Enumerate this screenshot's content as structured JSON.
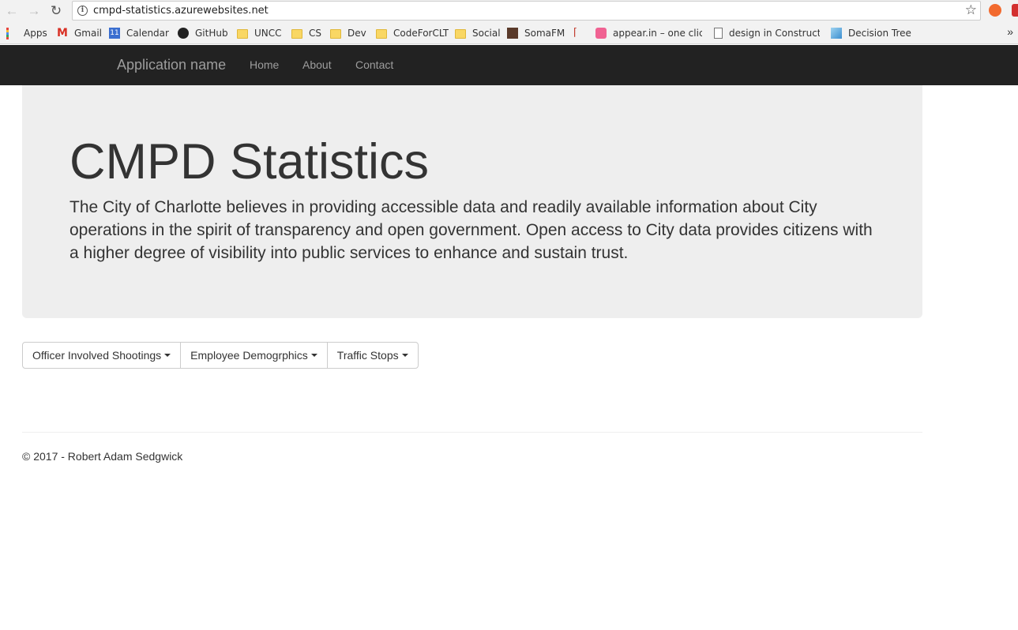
{
  "browser": {
    "url": "cmpd-statistics.azurewebsites.net",
    "bookmarks": [
      {
        "label": "Apps",
        "icon": "apps-icon"
      },
      {
        "label": "Gmail",
        "icon": "gmail-icon"
      },
      {
        "label": "Calendar",
        "icon": "calendar-icon",
        "badge": "11"
      },
      {
        "label": "GitHub",
        "icon": "github-icon"
      },
      {
        "label": "UNCC",
        "icon": "folder-icon"
      },
      {
        "label": "CS",
        "icon": "folder-icon"
      },
      {
        "label": "Dev",
        "icon": "folder-icon"
      },
      {
        "label": "CodeForCLT",
        "icon": "folder-icon"
      },
      {
        "label": "Social",
        "icon": "folder-icon"
      },
      {
        "label": "SomaFM",
        "icon": "somafm-icon"
      },
      {
        "label": "",
        "icon": "pickaxe-icon"
      },
      {
        "label": "appear.in – one click",
        "icon": "appear-in-icon"
      },
      {
        "label": "design in Constructio",
        "icon": "page-icon"
      },
      {
        "label": "Decision Tree",
        "icon": "decision-tree-icon"
      }
    ],
    "more": "»"
  },
  "navbar": {
    "brand": "Application name",
    "links": [
      "Home",
      "About",
      "Contact"
    ]
  },
  "jumbotron": {
    "title": "CMPD Statistics",
    "lead": "The City of Charlotte believes in providing accessible data and readily available information about City operations in the spirit of transparency and open government. Open access to City data provides citizens with a higher degree of visibility into public services to enhance and sustain trust."
  },
  "dropdowns": [
    "Officer Involved Shootings",
    "Employee Demogrphics",
    "Traffic Stops"
  ],
  "footer": {
    "text": "© 2017 - Robert Adam Sedgwick"
  },
  "colors": {
    "navbar": "#222222",
    "nav_text": "#9d9d9d",
    "jumbotron": "#eeeeee"
  }
}
